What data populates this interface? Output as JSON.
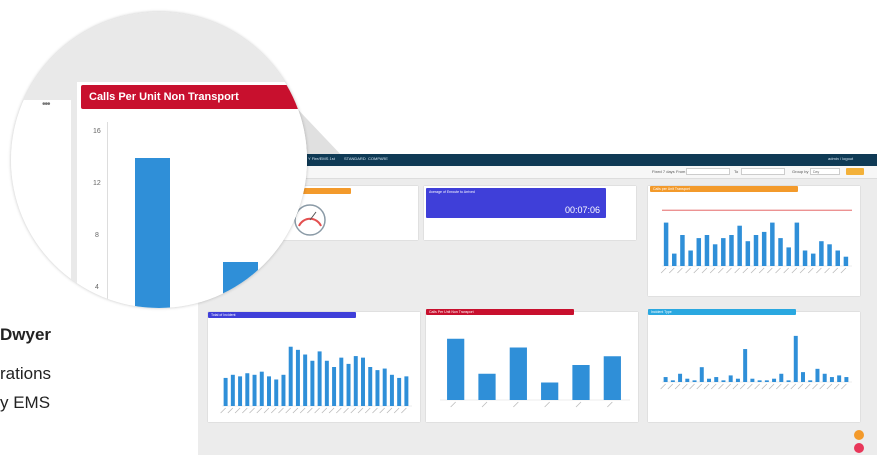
{
  "topbar": {
    "items": [
      "Y Fire/EMS 1st",
      "STANDARD",
      "COMPARE"
    ],
    "user": "admin / logout"
  },
  "filters": {
    "fixed_label": "Fixed 7 days",
    "from_label": "From",
    "to_label": "To",
    "group_label": "Group by",
    "group_value": "Day"
  },
  "cards": {
    "gauge_title": "",
    "avg_title": "Average of Enroute to Arrived",
    "avg_value": "00:07:06",
    "cbt_title": "Calls per Unit Transport",
    "total_title": "Total of Incident",
    "nontransport_title": "Calls Per Unit Non Transport",
    "inctype_title": "Incident Type"
  },
  "lens": {
    "title": "Calls Per Unit Non Transport",
    "ticks": [
      "16",
      "12",
      "8",
      "4"
    ],
    "menu": "•••"
  },
  "side_text": {
    "name": "Dwyer",
    "line2": "rations",
    "line3": "y EMS"
  },
  "colors": {
    "orange": "#f39a2b",
    "blue": "#2f8fd8",
    "indigo": "#3f3fd9",
    "red": "#c8102e",
    "cyan": "#2aa8e0",
    "navy": "#0f3a55"
  },
  "chart_data": [
    {
      "type": "bar",
      "title": "Calls per Unit Transport",
      "values": [
        14,
        4,
        10,
        5,
        9,
        10,
        7,
        9,
        10,
        13,
        8,
        10,
        11,
        14,
        9,
        6,
        14,
        5,
        4,
        8,
        7,
        5,
        3
      ],
      "reference_line": 18
    },
    {
      "type": "bar",
      "title": "Total of Incident",
      "values": [
        18,
        20,
        19,
        21,
        20,
        22,
        19,
        17,
        20,
        38,
        36,
        33,
        29,
        35,
        29,
        25,
        31,
        27,
        32,
        31,
        25,
        23,
        24,
        20,
        18,
        19
      ],
      "ylim": [
        0,
        50
      ]
    },
    {
      "type": "bar",
      "title": "Calls Per Unit Non Transport",
      "values": [
        14,
        6,
        12,
        4,
        8,
        10
      ]
    },
    {
      "type": "bar",
      "title": "Incident Type",
      "values": [
        3,
        1,
        5,
        2,
        1,
        9,
        2,
        3,
        1,
        4,
        2,
        20,
        2,
        1,
        1,
        2,
        5,
        1,
        28,
        6,
        1,
        8,
        5,
        3,
        4,
        3
      ]
    }
  ]
}
